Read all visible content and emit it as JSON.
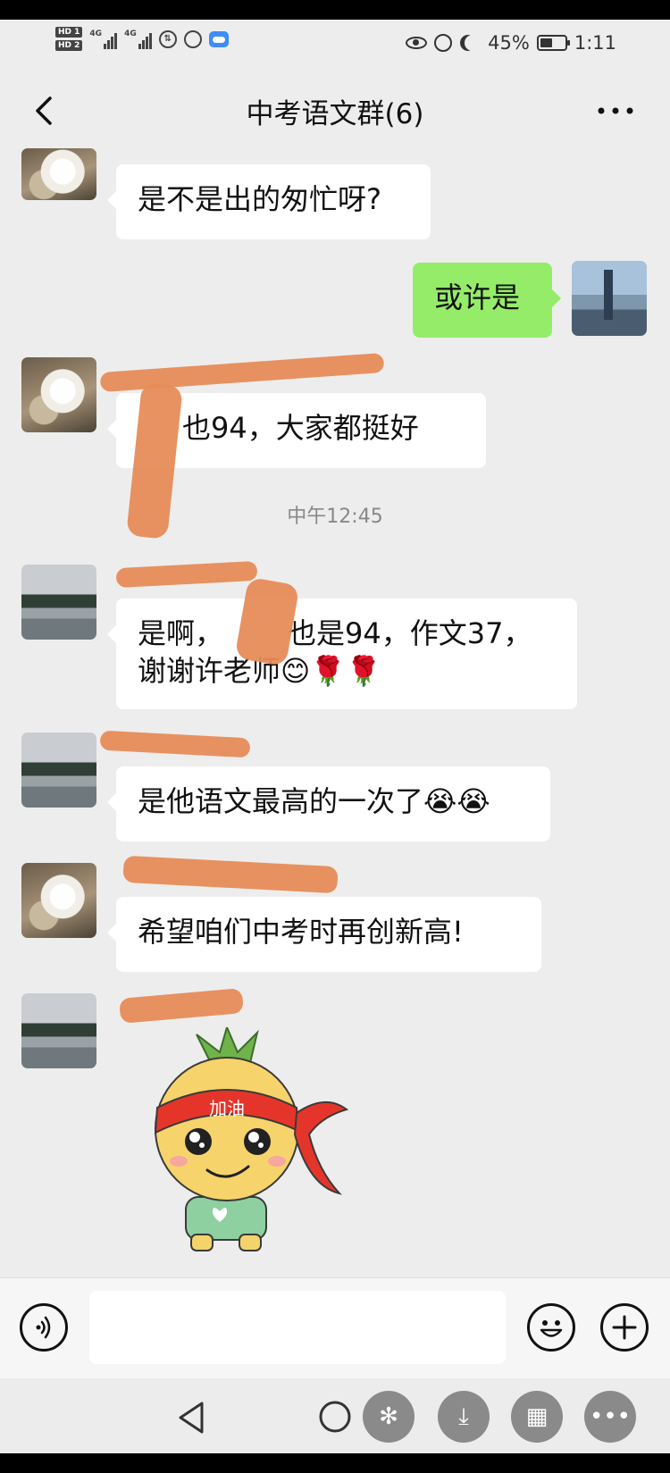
{
  "status_bar": {
    "hd1": "HD 1",
    "hd2": "HD 2",
    "signal_label_1": "4G",
    "signal_label_2": "4G",
    "battery": "45%",
    "time": "1:11"
  },
  "header": {
    "title": "中考语文群(6)"
  },
  "messages": [
    {
      "side": "left",
      "text": "是不是出的匆忙呀?"
    },
    {
      "side": "right",
      "text": "或许是"
    },
    {
      "side": "left",
      "text": "也94，大家都挺好"
    },
    {
      "side": "left",
      "text_line1": "是啊，",
      "text_line1b": "也是94，作文37，",
      "text_line2": "谢谢许老师😊🌹🌹"
    },
    {
      "side": "left",
      "text": "是他语文最高的一次了😭😭"
    },
    {
      "side": "left",
      "text": "希望咱们中考时再创新高!"
    }
  ],
  "timestamp": "中午12:45",
  "sticker": {
    "headband_text": "加油"
  },
  "icons": {
    "back": "back-chevron-icon",
    "more": "more-dots-icon",
    "voice": "voice-icon",
    "emoji": "emoji-icon",
    "plus": "plus-icon"
  }
}
